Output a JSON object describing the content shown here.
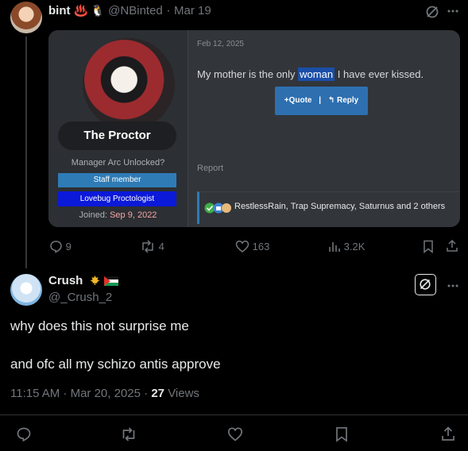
{
  "post1": {
    "author_name": "bint",
    "author_emoji": "♨️ 🐧",
    "handle": "@NBinted",
    "dot": "·",
    "date": "Mar 19",
    "embed": {
      "username": "The Proctor",
      "user_title": "Manager Arc Unlocked?",
      "banner_staff": "Staff member",
      "banner_lovebug": "Lovebug Proctologist",
      "joined_label": "Joined:",
      "joined_date": "Sep 9, 2022",
      "post_date": "Feb 12, 2025",
      "message_before": "My mother is the only",
      "message_highlight": "woman",
      "message_after": "I have ever kissed.",
      "quote_label": "+Quote",
      "divider": "|",
      "reply_label": "↰ Reply",
      "report_label": "Report",
      "reactions_text": "RestlessRain, Trap Supremacy, Saturnus and 2 others"
    },
    "stats": {
      "replies": "9",
      "reposts": "4",
      "likes": "163",
      "views": "3.2K"
    }
  },
  "post2": {
    "author_name": "Crush",
    "handle": "@_Crush_2",
    "text_line1": "why does this not surprise me",
    "text_line2": "and ofc all my schizo antis approve",
    "timestamp": "11:15 AM · Mar 20, 2025 ·",
    "views_count": "27",
    "views_label": "Views"
  },
  "colors": {
    "background": "#000000",
    "text": "#e7e9ea",
    "muted": "#71767b",
    "staff_banner": "#2e7bb6",
    "lovebug_banner": "#0b19d8",
    "quote_button": "#2e6fb0"
  }
}
